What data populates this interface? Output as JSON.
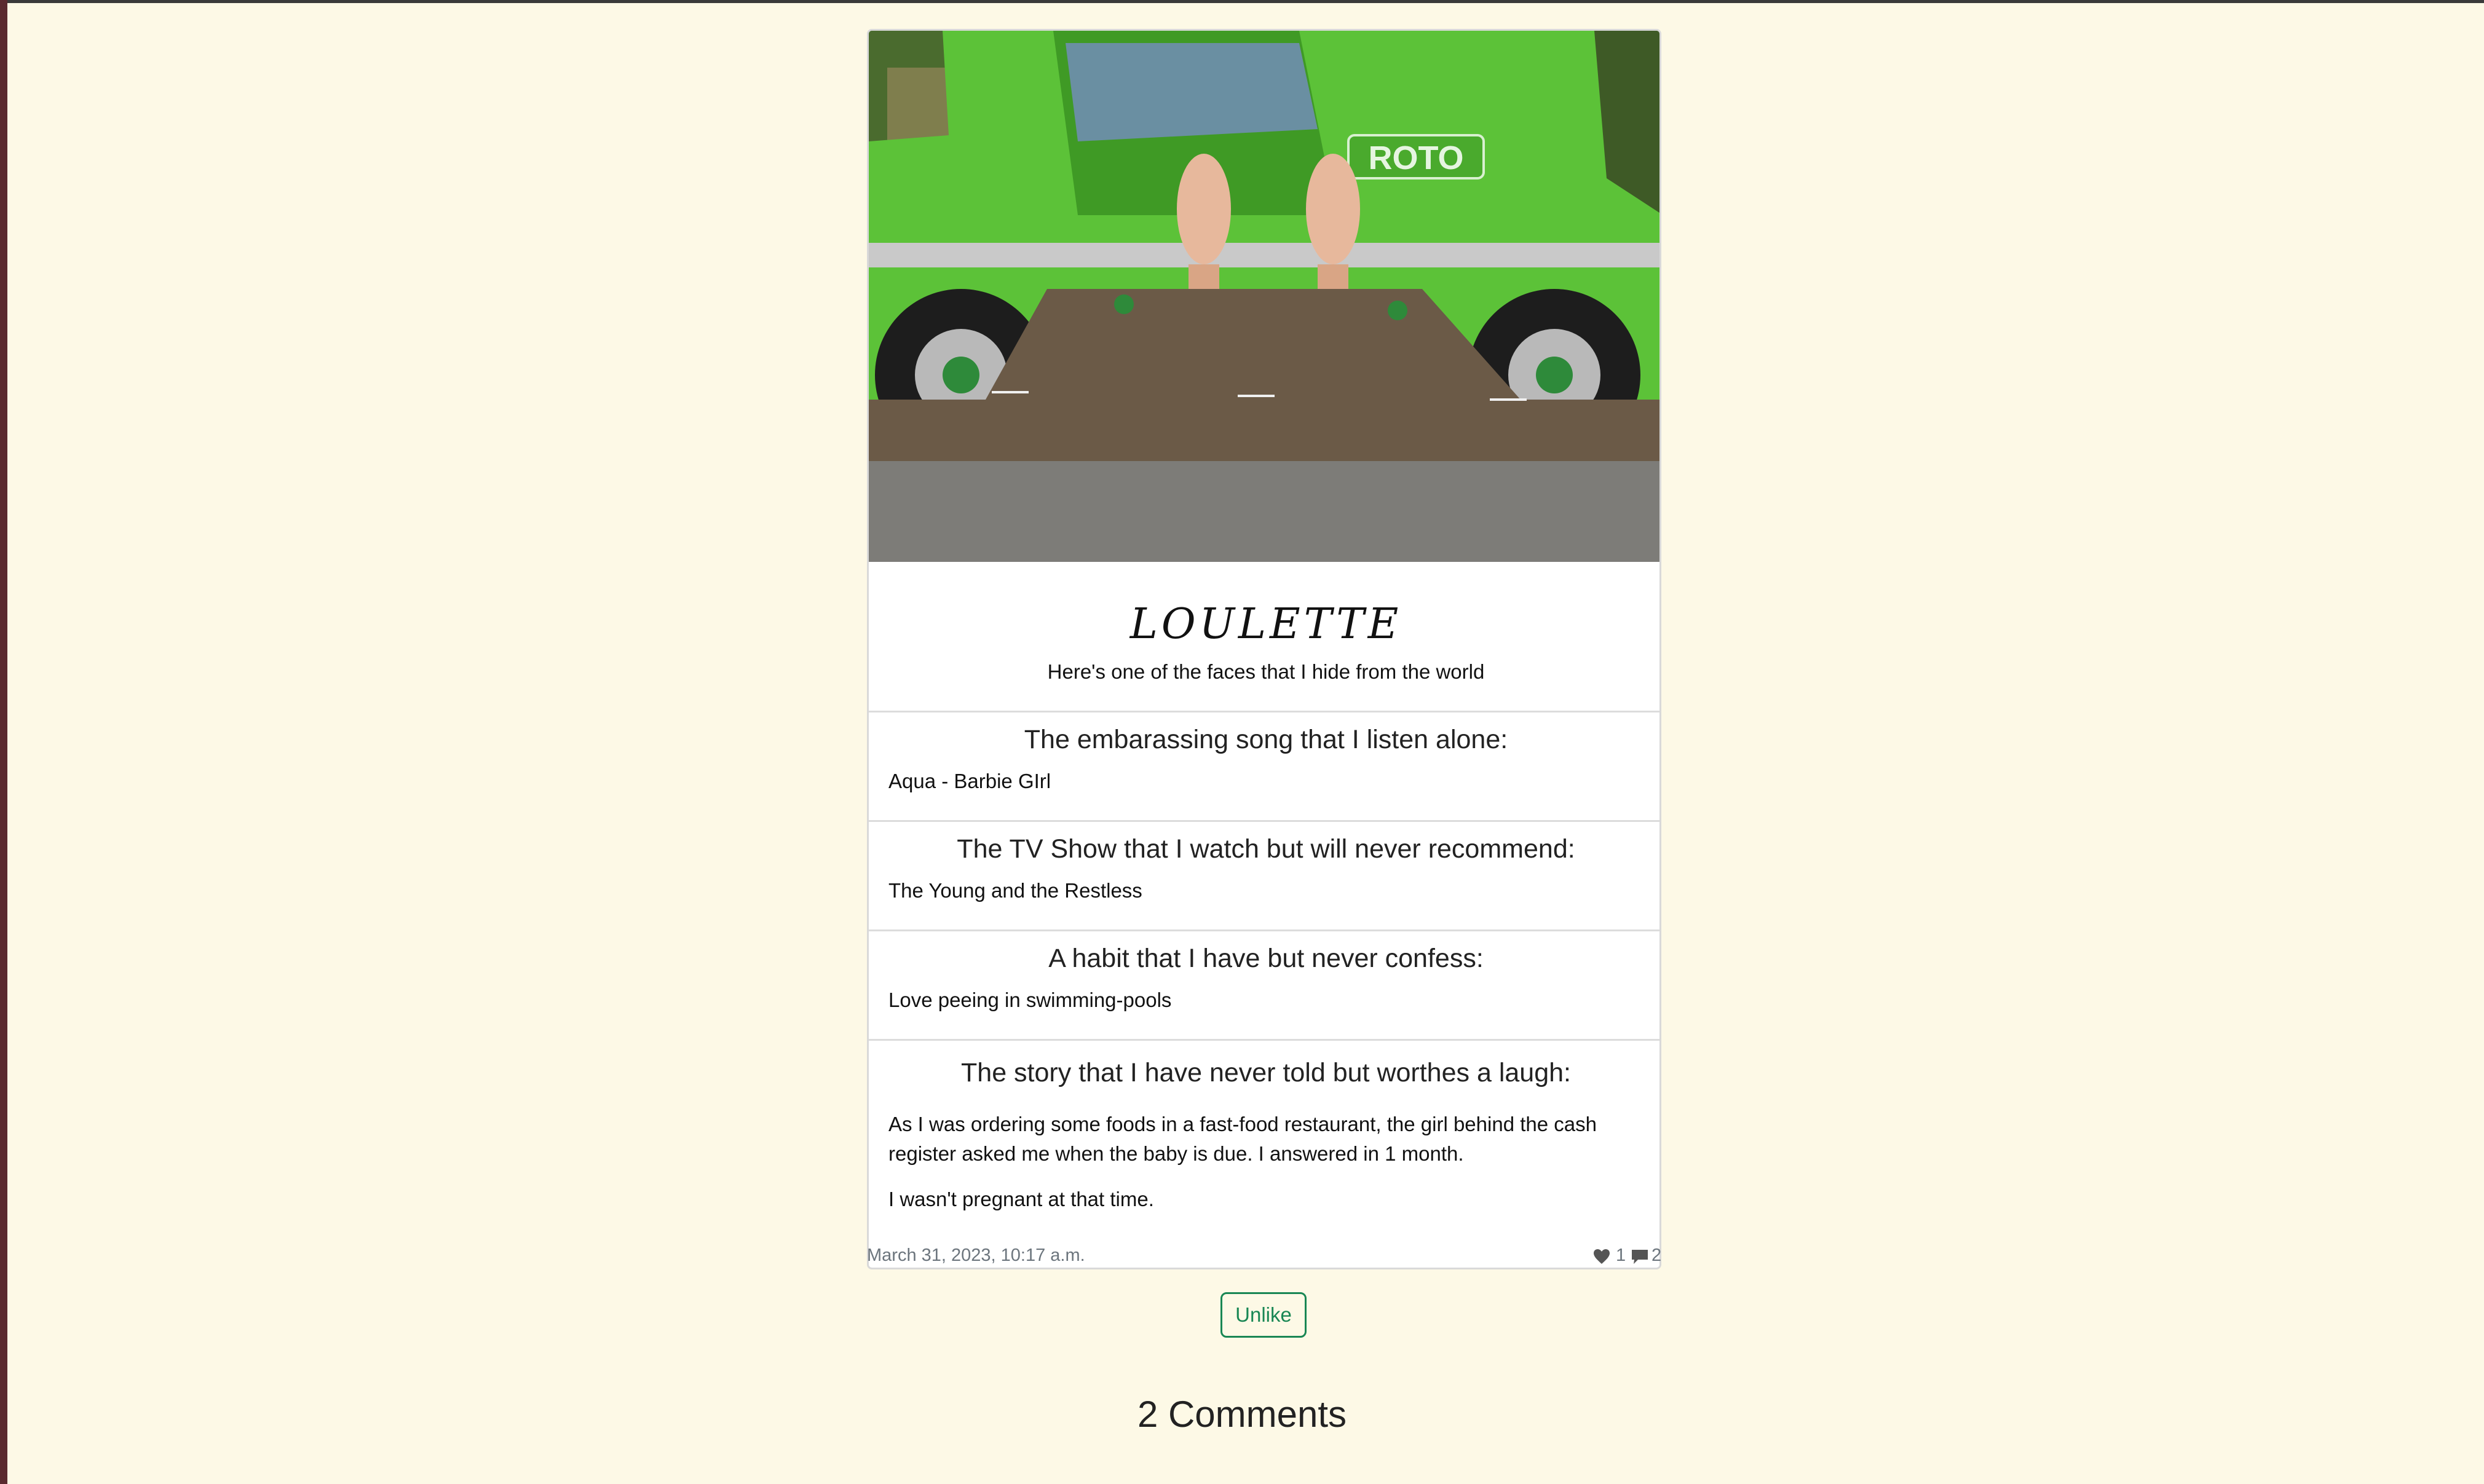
{
  "post": {
    "image": {
      "alt": "photo",
      "label": "ROTO"
    },
    "title": "LOULETTE",
    "subtitle": "Here's one of the faces that I hide from the world",
    "sections": [
      {
        "question": "The embarassing song that I listen alone:",
        "answer": [
          "Aqua - Barbie GIrl"
        ]
      },
      {
        "question": "The TV Show that I watch but will never recommend:",
        "answer": [
          "The Young and the Restless"
        ]
      },
      {
        "question": "A habit that I have but never confess:",
        "answer": [
          "Love peeing in swimming-pools"
        ]
      },
      {
        "question": "The story that I have never told but worthes a laugh:",
        "answer": [
          "As I was ordering some foods in a fast-food restaurant, the girl behind the cash register asked me when the baby is due. I answered in 1 month.",
          "I wasn't pregnant at that time."
        ]
      }
    ],
    "date": "March 31, 2023, 10:17 a.m.",
    "likes": "1",
    "comments_count": "2",
    "icons": {
      "like": "heart-icon",
      "comment": "comment-icon"
    }
  },
  "actions": {
    "unlike_label": "Unlike"
  },
  "comments": {
    "heading": "2 Comments"
  },
  "colors": {
    "background": "#fdf9e6",
    "accent": "#198754"
  }
}
